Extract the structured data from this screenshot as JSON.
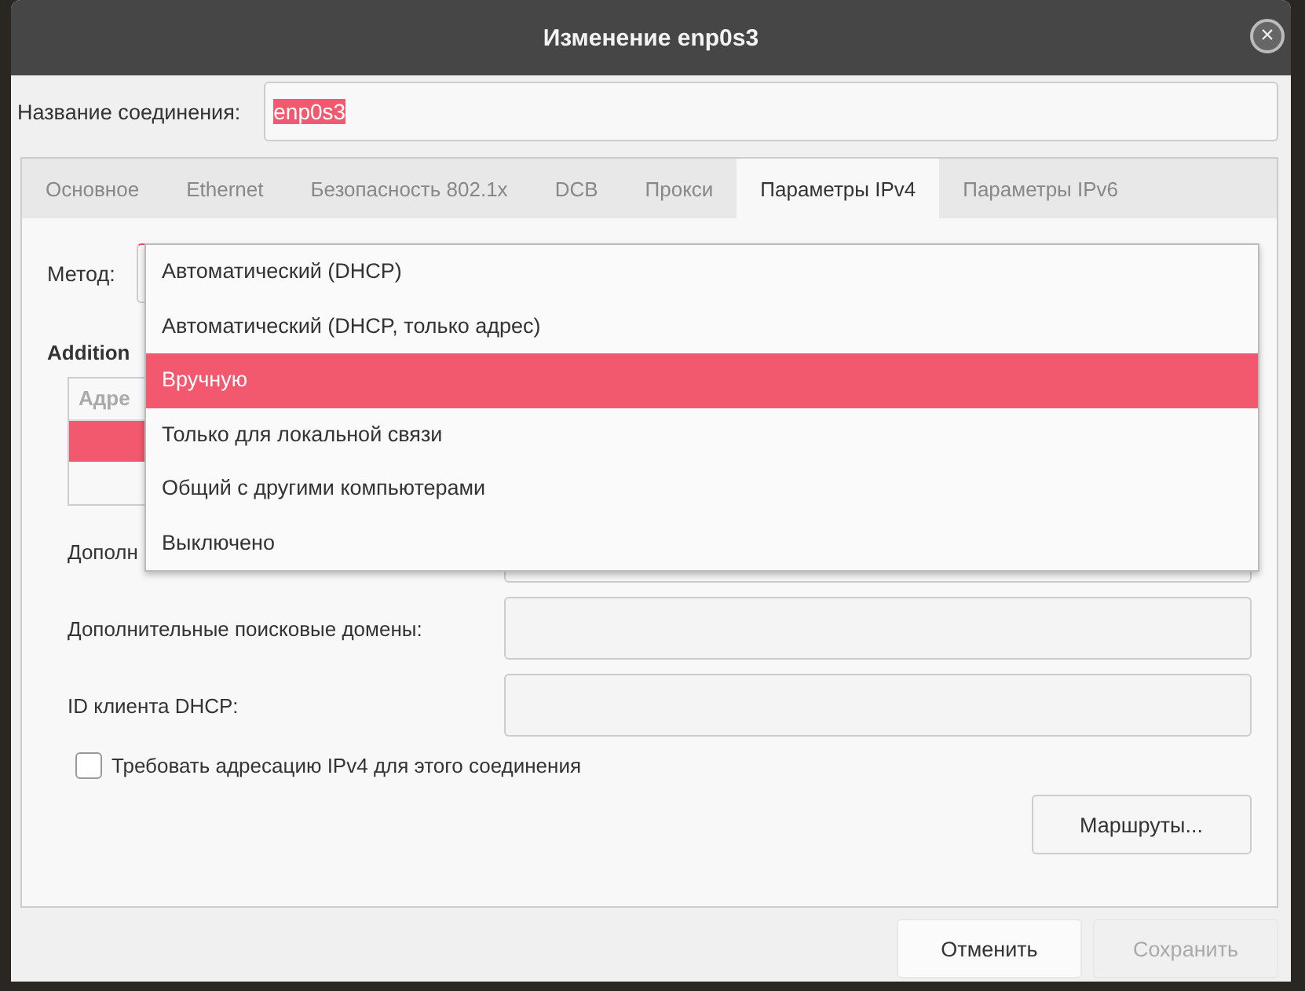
{
  "window": {
    "title": "Изменение enp0s3",
    "close": "×"
  },
  "connection_name": {
    "label": "Название соединения:",
    "value": "enp0s3",
    "value_selected": true
  },
  "tabs": [
    {
      "label": "Основное",
      "selected": false
    },
    {
      "label": "Ethernet",
      "selected": false
    },
    {
      "label": "Безопасность 802.1x",
      "selected": false
    },
    {
      "label": "DCB",
      "selected": false
    },
    {
      "label": "Прокси",
      "selected": false
    },
    {
      "label": "Параметры IPv4",
      "selected": true
    },
    {
      "label": "Параметры IPv6",
      "selected": false
    }
  ],
  "method": {
    "label": "Метод:",
    "options": [
      {
        "label": "Автоматический (DHCP)",
        "selected": false
      },
      {
        "label": "Автоматический (DHCP, только адрес)",
        "selected": false
      },
      {
        "label": "Вручную",
        "selected": true
      },
      {
        "label": "Только для локальной связи",
        "selected": false
      },
      {
        "label": "Общий с другими компьютерами",
        "selected": false
      },
      {
        "label": "Выключено",
        "selected": false
      }
    ]
  },
  "addresses": {
    "heading": "Addition",
    "column_1": "Адре",
    "rows": [
      {
        "selected": true
      },
      {
        "selected": false
      }
    ]
  },
  "fields": [
    {
      "label": "Дополн"
    },
    {
      "label": "Дополнительные поисковые домены:"
    },
    {
      "label": "ID клиента DHCP:"
    }
  ],
  "require_ipv4": {
    "label": "Требовать адресацию IPv4 для этого соединения",
    "checked": false
  },
  "routes_button": "Маршруты...",
  "buttons": [
    {
      "label": "Отменить",
      "disabled": false
    },
    {
      "label": "Сохранить",
      "disabled": true
    }
  ]
}
